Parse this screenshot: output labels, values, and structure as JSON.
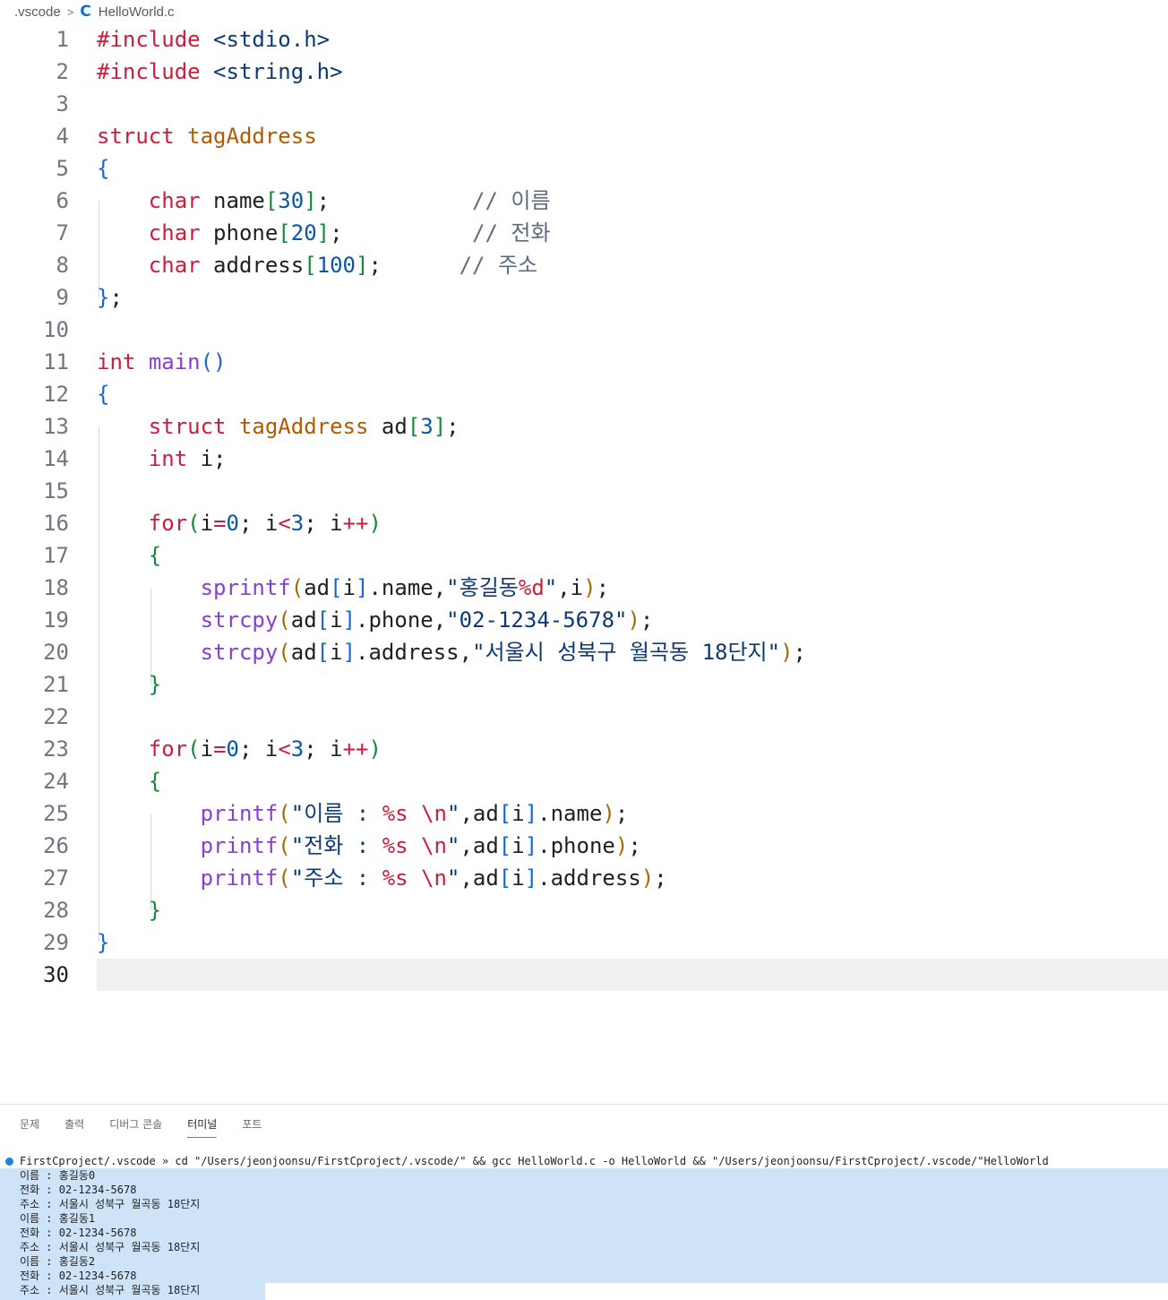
{
  "breadcrumb": {
    "folder": ".vscode",
    "separator": ">",
    "file_icon": "c-language-icon",
    "file": "HelloWorld.c"
  },
  "editor": {
    "active_line": 30,
    "lines": [
      {
        "n": 1,
        "tokens": [
          {
            "t": "#include",
            "c": "kw"
          },
          {
            "t": " ",
            "c": "tx"
          },
          {
            "t": "<stdio.h>",
            "c": "str"
          }
        ]
      },
      {
        "n": 2,
        "tokens": [
          {
            "t": "#include",
            "c": "kw"
          },
          {
            "t": " ",
            "c": "tx"
          },
          {
            "t": "<string.h>",
            "c": "str"
          }
        ]
      },
      {
        "n": 3,
        "tokens": []
      },
      {
        "n": 4,
        "tokens": [
          {
            "t": "struct",
            "c": "kw"
          },
          {
            "t": " ",
            "c": "tx"
          },
          {
            "t": "tagAddress",
            "c": "ty"
          }
        ]
      },
      {
        "n": 5,
        "tokens": [
          {
            "t": "{",
            "c": "b1"
          }
        ]
      },
      {
        "n": 6,
        "tokens": [
          {
            "t": "    ",
            "c": "tx"
          },
          {
            "t": "char",
            "c": "kw"
          },
          {
            "t": " name",
            "c": "tx"
          },
          {
            "t": "[",
            "c": "b2"
          },
          {
            "t": "30",
            "c": "num"
          },
          {
            "t": "]",
            "c": "b2"
          },
          {
            "t": ";           ",
            "c": "tx"
          },
          {
            "t": "// 이름",
            "c": "cm"
          }
        ]
      },
      {
        "n": 7,
        "tokens": [
          {
            "t": "    ",
            "c": "tx"
          },
          {
            "t": "char",
            "c": "kw"
          },
          {
            "t": " phone",
            "c": "tx"
          },
          {
            "t": "[",
            "c": "b2"
          },
          {
            "t": "20",
            "c": "num"
          },
          {
            "t": "]",
            "c": "b2"
          },
          {
            "t": ";          ",
            "c": "tx"
          },
          {
            "t": "// 전화",
            "c": "cm"
          }
        ]
      },
      {
        "n": 8,
        "tokens": [
          {
            "t": "    ",
            "c": "tx"
          },
          {
            "t": "char",
            "c": "kw"
          },
          {
            "t": " address",
            "c": "tx"
          },
          {
            "t": "[",
            "c": "b2"
          },
          {
            "t": "100",
            "c": "num"
          },
          {
            "t": "]",
            "c": "b2"
          },
          {
            "t": ";      ",
            "c": "tx"
          },
          {
            "t": "// 주소",
            "c": "cm"
          }
        ]
      },
      {
        "n": 9,
        "tokens": [
          {
            "t": "}",
            "c": "b1"
          },
          {
            "t": ";",
            "c": "tx"
          }
        ]
      },
      {
        "n": 10,
        "tokens": []
      },
      {
        "n": 11,
        "tokens": [
          {
            "t": "int",
            "c": "kw"
          },
          {
            "t": " ",
            "c": "tx"
          },
          {
            "t": "main",
            "c": "fn"
          },
          {
            "t": "()",
            "c": "b1"
          }
        ]
      },
      {
        "n": 12,
        "tokens": [
          {
            "t": "{",
            "c": "b1"
          }
        ]
      },
      {
        "n": 13,
        "tokens": [
          {
            "t": "    ",
            "c": "tx"
          },
          {
            "t": "struct",
            "c": "kw"
          },
          {
            "t": " ",
            "c": "tx"
          },
          {
            "t": "tagAddress",
            "c": "ty"
          },
          {
            "t": " ad",
            "c": "tx"
          },
          {
            "t": "[",
            "c": "b2"
          },
          {
            "t": "3",
            "c": "num"
          },
          {
            "t": "]",
            "c": "b2"
          },
          {
            "t": ";",
            "c": "tx"
          }
        ]
      },
      {
        "n": 14,
        "tokens": [
          {
            "t": "    ",
            "c": "tx"
          },
          {
            "t": "int",
            "c": "kw"
          },
          {
            "t": " i;",
            "c": "tx"
          }
        ]
      },
      {
        "n": 15,
        "tokens": []
      },
      {
        "n": 16,
        "tokens": [
          {
            "t": "    ",
            "c": "tx"
          },
          {
            "t": "for",
            "c": "kw"
          },
          {
            "t": "(",
            "c": "b2"
          },
          {
            "t": "i",
            "c": "tx"
          },
          {
            "t": "=",
            "c": "kw"
          },
          {
            "t": "0",
            "c": "num"
          },
          {
            "t": "; i",
            "c": "tx"
          },
          {
            "t": "<",
            "c": "kw"
          },
          {
            "t": "3",
            "c": "num"
          },
          {
            "t": "; i",
            "c": "tx"
          },
          {
            "t": "++",
            "c": "kw"
          },
          {
            "t": ")",
            "c": "b2"
          }
        ]
      },
      {
        "n": 17,
        "tokens": [
          {
            "t": "    ",
            "c": "tx"
          },
          {
            "t": "{",
            "c": "b2"
          }
        ]
      },
      {
        "n": 18,
        "tokens": [
          {
            "t": "        ",
            "c": "tx"
          },
          {
            "t": "sprintf",
            "c": "fn"
          },
          {
            "t": "(",
            "c": "b3"
          },
          {
            "t": "ad",
            "c": "tx"
          },
          {
            "t": "[",
            "c": "b1"
          },
          {
            "t": "i",
            "c": "tx"
          },
          {
            "t": "]",
            "c": "b1"
          },
          {
            "t": ".name,",
            "c": "tx"
          },
          {
            "t": "\"홍길동",
            "c": "str"
          },
          {
            "t": "%d",
            "c": "esc"
          },
          {
            "t": "\"",
            "c": "str"
          },
          {
            "t": ",i",
            "c": "tx"
          },
          {
            "t": ")",
            "c": "b3"
          },
          {
            "t": ";",
            "c": "tx"
          }
        ]
      },
      {
        "n": 19,
        "tokens": [
          {
            "t": "        ",
            "c": "tx"
          },
          {
            "t": "strcpy",
            "c": "fn"
          },
          {
            "t": "(",
            "c": "b3"
          },
          {
            "t": "ad",
            "c": "tx"
          },
          {
            "t": "[",
            "c": "b1"
          },
          {
            "t": "i",
            "c": "tx"
          },
          {
            "t": "]",
            "c": "b1"
          },
          {
            "t": ".phone,",
            "c": "tx"
          },
          {
            "t": "\"02-1234-5678\"",
            "c": "str"
          },
          {
            "t": ")",
            "c": "b3"
          },
          {
            "t": ";",
            "c": "tx"
          }
        ]
      },
      {
        "n": 20,
        "tokens": [
          {
            "t": "        ",
            "c": "tx"
          },
          {
            "t": "strcpy",
            "c": "fn"
          },
          {
            "t": "(",
            "c": "b3"
          },
          {
            "t": "ad",
            "c": "tx"
          },
          {
            "t": "[",
            "c": "b1"
          },
          {
            "t": "i",
            "c": "tx"
          },
          {
            "t": "]",
            "c": "b1"
          },
          {
            "t": ".address,",
            "c": "tx"
          },
          {
            "t": "\"서울시 성북구 월곡동 18단지\"",
            "c": "str"
          },
          {
            "t": ")",
            "c": "b3"
          },
          {
            "t": ";",
            "c": "tx"
          }
        ]
      },
      {
        "n": 21,
        "tokens": [
          {
            "t": "    ",
            "c": "tx"
          },
          {
            "t": "}",
            "c": "b2"
          }
        ]
      },
      {
        "n": 22,
        "tokens": []
      },
      {
        "n": 23,
        "tokens": [
          {
            "t": "    ",
            "c": "tx"
          },
          {
            "t": "for",
            "c": "kw"
          },
          {
            "t": "(",
            "c": "b2"
          },
          {
            "t": "i",
            "c": "tx"
          },
          {
            "t": "=",
            "c": "kw"
          },
          {
            "t": "0",
            "c": "num"
          },
          {
            "t": "; i",
            "c": "tx"
          },
          {
            "t": "<",
            "c": "kw"
          },
          {
            "t": "3",
            "c": "num"
          },
          {
            "t": "; i",
            "c": "tx"
          },
          {
            "t": "++",
            "c": "kw"
          },
          {
            "t": ")",
            "c": "b2"
          }
        ]
      },
      {
        "n": 24,
        "tokens": [
          {
            "t": "    ",
            "c": "tx"
          },
          {
            "t": "{",
            "c": "b2"
          }
        ]
      },
      {
        "n": 25,
        "tokens": [
          {
            "t": "        ",
            "c": "tx"
          },
          {
            "t": "printf",
            "c": "fn"
          },
          {
            "t": "(",
            "c": "b3"
          },
          {
            "t": "\"이름 : ",
            "c": "str"
          },
          {
            "t": "%s",
            "c": "esc"
          },
          {
            "t": " ",
            "c": "str"
          },
          {
            "t": "\\n",
            "c": "esc"
          },
          {
            "t": "\"",
            "c": "str"
          },
          {
            "t": ",ad",
            "c": "tx"
          },
          {
            "t": "[",
            "c": "b1"
          },
          {
            "t": "i",
            "c": "tx"
          },
          {
            "t": "]",
            "c": "b1"
          },
          {
            "t": ".name",
            "c": "tx"
          },
          {
            "t": ")",
            "c": "b3"
          },
          {
            "t": ";",
            "c": "tx"
          }
        ]
      },
      {
        "n": 26,
        "tokens": [
          {
            "t": "        ",
            "c": "tx"
          },
          {
            "t": "printf",
            "c": "fn"
          },
          {
            "t": "(",
            "c": "b3"
          },
          {
            "t": "\"전화 : ",
            "c": "str"
          },
          {
            "t": "%s",
            "c": "esc"
          },
          {
            "t": " ",
            "c": "str"
          },
          {
            "t": "\\n",
            "c": "esc"
          },
          {
            "t": "\"",
            "c": "str"
          },
          {
            "t": ",ad",
            "c": "tx"
          },
          {
            "t": "[",
            "c": "b1"
          },
          {
            "t": "i",
            "c": "tx"
          },
          {
            "t": "]",
            "c": "b1"
          },
          {
            "t": ".phone",
            "c": "tx"
          },
          {
            "t": ")",
            "c": "b3"
          },
          {
            "t": ";",
            "c": "tx"
          }
        ]
      },
      {
        "n": 27,
        "tokens": [
          {
            "t": "        ",
            "c": "tx"
          },
          {
            "t": "printf",
            "c": "fn"
          },
          {
            "t": "(",
            "c": "b3"
          },
          {
            "t": "\"주소 : ",
            "c": "str"
          },
          {
            "t": "%s",
            "c": "esc"
          },
          {
            "t": " ",
            "c": "str"
          },
          {
            "t": "\\n",
            "c": "esc"
          },
          {
            "t": "\"",
            "c": "str"
          },
          {
            "t": ",ad",
            "c": "tx"
          },
          {
            "t": "[",
            "c": "b1"
          },
          {
            "t": "i",
            "c": "tx"
          },
          {
            "t": "]",
            "c": "b1"
          },
          {
            "t": ".address",
            "c": "tx"
          },
          {
            "t": ")",
            "c": "b3"
          },
          {
            "t": ";",
            "c": "tx"
          }
        ]
      },
      {
        "n": 28,
        "tokens": [
          {
            "t": "    ",
            "c": "tx"
          },
          {
            "t": "}",
            "c": "b2"
          }
        ]
      },
      {
        "n": 29,
        "tokens": [
          {
            "t": "}",
            "c": "b1"
          }
        ]
      },
      {
        "n": 30,
        "tokens": []
      }
    ]
  },
  "panel": {
    "tabs": [
      {
        "label": "문제",
        "active": false
      },
      {
        "label": "출력",
        "active": false
      },
      {
        "label": "디버그 콘솔",
        "active": false
      },
      {
        "label": "터미널",
        "active": true
      },
      {
        "label": "포트",
        "active": false
      }
    ],
    "terminal": {
      "command": "FirstCproject/.vscode » cd \"/Users/jeonjoonsu/FirstCproject/.vscode/\" && gcc HelloWorld.c -o HelloWorld && \"/Users/jeonjoonsu/FirstCproject/.vscode/\"HelloWorld",
      "output": [
        "이름 : 홍길동0",
        "전화 : 02-1234-5678",
        "주소 : 서울시 성북구 월곡동 18단지",
        "이름 : 홍길동1",
        "전화 : 02-1234-5678",
        "주소 : 서울시 성북구 월곡동 18단지",
        "이름 : 홍길동2",
        "전화 : 02-1234-5678",
        "주소 : 서울시 성북구 월곡동 18단지"
      ]
    }
  },
  "colors": {
    "keyword": "#cd1d3b",
    "type": "#b35a00",
    "function": "#8a3dd6",
    "number": "#0b55a8",
    "string": "#0e3a73",
    "comment": "#5f6c7b",
    "terminal_selection": "#cfe3f8",
    "active_tab_underline": "#e05a3c"
  }
}
